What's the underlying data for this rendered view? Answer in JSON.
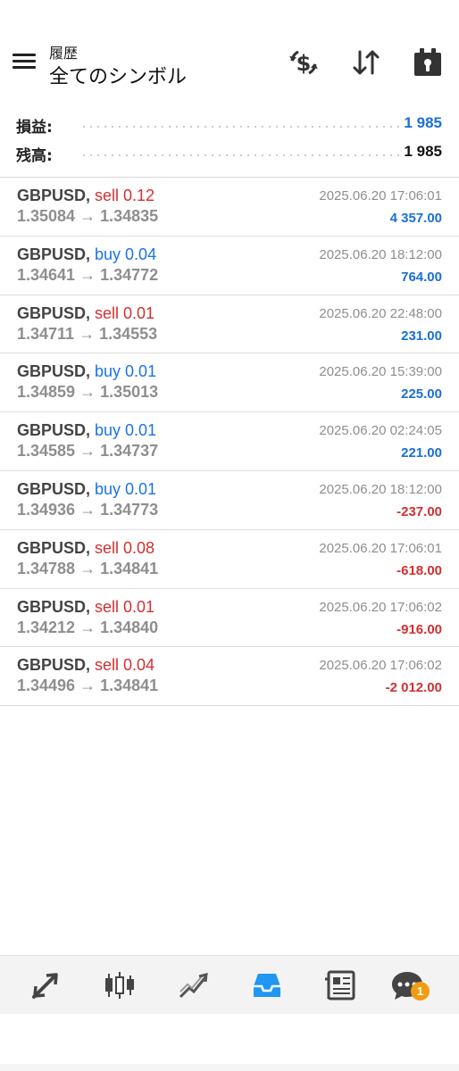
{
  "header": {
    "subtitle": "履歴",
    "title": "全てのシンボル",
    "icons": [
      "menu-icon",
      "currency-exchange-icon",
      "sort-icon",
      "calendar-period-icon"
    ]
  },
  "summary": {
    "profit_label": "損益:",
    "profit_value": "1 985",
    "balance_label": "残高:",
    "balance_value": "1 985"
  },
  "colors": {
    "buy": "#1a73e8",
    "sell": "#d32f2f",
    "positive": "#1a6fd6",
    "negative": "#d32f2f",
    "muted": "#8e8e8e",
    "accent_active": "#2196f3",
    "badge": "#f39c12"
  },
  "trades": [
    {
      "symbol": "GBPUSD,",
      "side": "sell",
      "volume": "0.12",
      "prices": "1.35084 → 1.34835",
      "time": "2025.06.20 17:06:01",
      "profit": "4 357.00"
    },
    {
      "symbol": "GBPUSD,",
      "side": "buy",
      "volume": "0.04",
      "prices": "1.34641 → 1.34772",
      "time": "2025.06.20 18:12:00",
      "profit": "764.00"
    },
    {
      "symbol": "GBPUSD,",
      "side": "sell",
      "volume": "0.01",
      "prices": "1.34711 → 1.34553",
      "time": "2025.06.20 22:48:00",
      "profit": "231.00"
    },
    {
      "symbol": "GBPUSD,",
      "side": "buy",
      "volume": "0.01",
      "prices": "1.34859 → 1.35013",
      "time": "2025.06.20 15:39:00",
      "profit": "225.00"
    },
    {
      "symbol": "GBPUSD,",
      "side": "buy",
      "volume": "0.01",
      "prices": "1.34585 → 1.34737",
      "time": "2025.06.20 02:24:05",
      "profit": "221.00"
    },
    {
      "symbol": "GBPUSD,",
      "side": "buy",
      "volume": "0.01",
      "prices": "1.34936 → 1.34773",
      "time": "2025.06.20 18:12:00",
      "profit": "-237.00"
    },
    {
      "symbol": "GBPUSD,",
      "side": "sell",
      "volume": "0.08",
      "prices": "1.34788 → 1.34841",
      "time": "2025.06.20 17:06:01",
      "profit": "-618.00"
    },
    {
      "symbol": "GBPUSD,",
      "side": "sell",
      "volume": "0.01",
      "prices": "1.34212 → 1.34840",
      "time": "2025.06.20 17:06:02",
      "profit": "-916.00"
    },
    {
      "symbol": "GBPUSD,",
      "side": "sell",
      "volume": "0.04",
      "prices": "1.34496 → 1.34841",
      "time": "2025.06.20 17:06:02",
      "profit": "-2 012.00"
    }
  ],
  "bottom_nav": {
    "items": [
      {
        "name": "quotes-icon",
        "active": false
      },
      {
        "name": "chart-icon",
        "active": false
      },
      {
        "name": "trade-icon",
        "active": false
      },
      {
        "name": "history-icon",
        "active": true
      },
      {
        "name": "news-icon",
        "active": false
      },
      {
        "name": "chat-icon",
        "active": false
      }
    ],
    "chat_badge": "1"
  }
}
